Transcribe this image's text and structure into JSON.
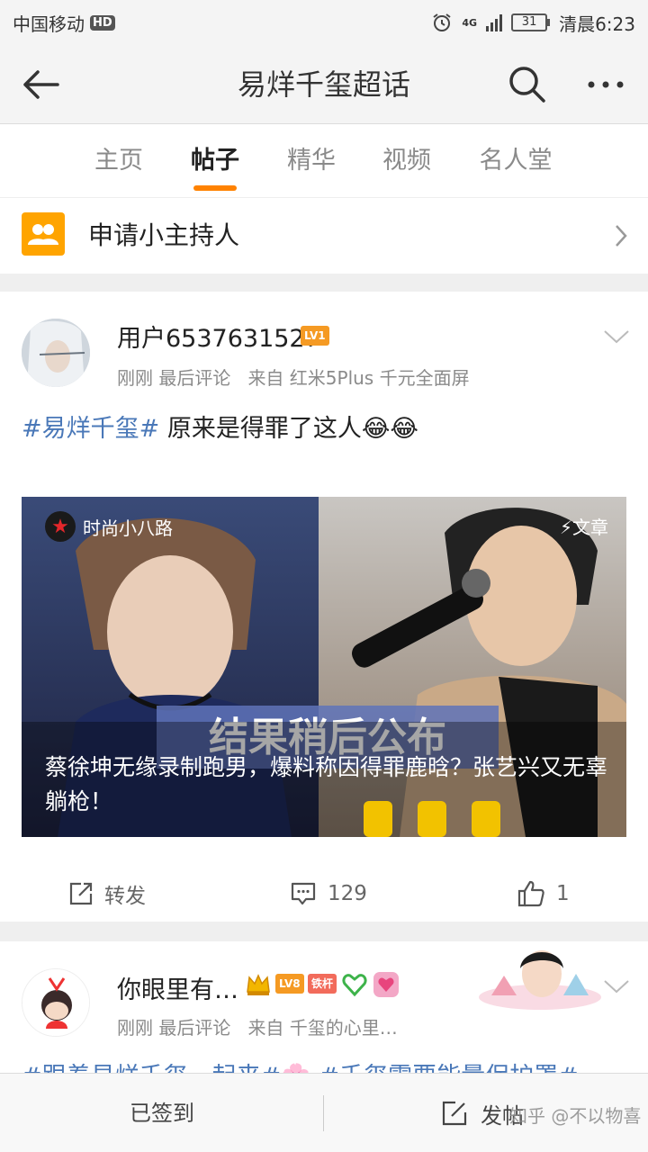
{
  "status_bar": {
    "carrier": "中国移动",
    "hd_badge": "HD",
    "network": "4G",
    "battery": "31",
    "time": "清晨6:23"
  },
  "nav": {
    "title": "易烊千玺超话"
  },
  "tabs": [
    {
      "label": "主页"
    },
    {
      "label": "帖子"
    },
    {
      "label": "精华"
    },
    {
      "label": "视频"
    },
    {
      "label": "名人堂"
    }
  ],
  "apply_row": {
    "label": "申请小主持人"
  },
  "post1": {
    "username": "用户6537631527",
    "level_badge": "LV1",
    "meta_time": "刚刚",
    "meta_last": "最后评论",
    "meta_from": "来自 红米5Plus 千元全面屏",
    "hashtag": "#易烊千玺#",
    "text": "原来是得罪了这人😂😂",
    "article": {
      "source_name": "时尚小八路",
      "type_label": "⚡文章",
      "headline": "蔡徐坤无缘录制跑男，爆料称因得罪鹿晗？张艺兴又无辜躺枪！",
      "image_caption": "结果稍后公布"
    },
    "actions": {
      "repost_label": "转发",
      "comment_count": "129",
      "like_count": "1"
    }
  },
  "post2": {
    "username": "你眼里有…",
    "level_badge": "LV8",
    "fan_badge": "铁杆",
    "meta_time": "刚刚",
    "meta_last": "最后评论",
    "meta_from": "来自 千玺的心里…",
    "text_partial": "#跟着易烊千玺一起来#🌸 #千玺需要能量保护罩#"
  },
  "bottom_bar": {
    "checked_in_label": "已签到",
    "post_label": "发帖"
  },
  "watermark": "知乎 @不以物喜",
  "colors": {
    "accent_orange": "#ff8200",
    "hashtag_blue": "#4a78b8",
    "level_orange": "#f59a23"
  }
}
